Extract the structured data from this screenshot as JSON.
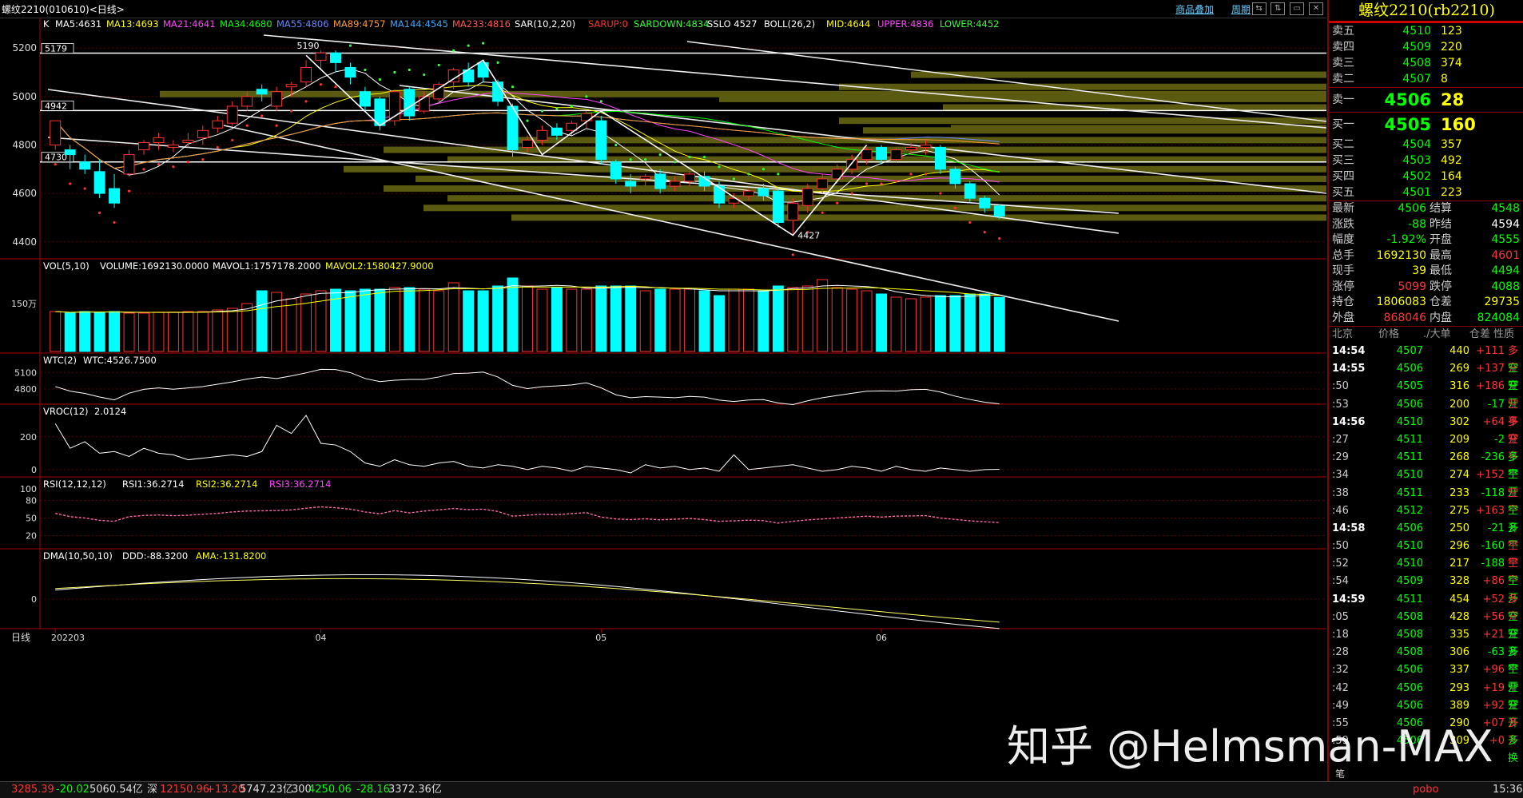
{
  "window": {
    "title": "螺纹2210(010610)<日线>",
    "links": [
      "商品叠加",
      "周期"
    ],
    "buttons": [
      "⇆",
      "⇅",
      "▭",
      "✕"
    ]
  },
  "panes": {
    "main": {
      "legend": [
        {
          "t": "K",
          "color": "#ffffff"
        },
        {
          "t": "MA5:4631",
          "color": "#ffffff"
        },
        {
          "t": "MA13:4693",
          "color": "#ffff00"
        },
        {
          "t": "MA21:4641",
          "color": "#ff44ff"
        },
        {
          "t": "MA34:4680",
          "color": "#00ff00"
        },
        {
          "t": "MA55:4806",
          "color": "#6688ff"
        },
        {
          "t": "MA89:4757",
          "color": "#ff9933"
        },
        {
          "t": "MA144:4545",
          "color": "#33aaff"
        },
        {
          "t": "MA233:4816",
          "color": "#ff5555"
        },
        {
          "t": "SAR(10,2,20)",
          "color": "#ffffff"
        },
        {
          "t": "SARUP:0",
          "color": "#ff3333"
        },
        {
          "t": "SARDOWN:4834",
          "color": "#33ff33"
        },
        {
          "t": "SSLO 4527",
          "color": "#ffffff"
        },
        {
          "t": "BOLL(26,2)",
          "color": "#ffffff"
        },
        {
          "t": "MID:4644",
          "color": "#ffff00"
        },
        {
          "t": "UPPER:4836",
          "color": "#ff44ff"
        },
        {
          "t": "LOWER:4452",
          "color": "#33ff33"
        }
      ],
      "yaxis": [
        "5200",
        "5000",
        "4800",
        "4600",
        "4400"
      ],
      "levels": [
        "5179",
        "4942",
        "4730"
      ],
      "annotations": [
        "5190",
        "4427"
      ]
    },
    "vol": {
      "legend": [
        {
          "t": "VOL(5,10)",
          "color": "#ffffff"
        },
        {
          "t": "VOLUME:1692130.0000",
          "color": "#ffffff"
        },
        {
          "t": "MAVOL1:1757178.2000",
          "color": "#ffffff"
        },
        {
          "t": "MAVOL2:1580427.9000",
          "color": "#ffff00"
        }
      ],
      "yaxis": [
        "150万"
      ]
    },
    "wtc": {
      "legend": [
        {
          "t": "WTC(2)",
          "color": "#ffffff"
        },
        {
          "t": "WTC:4526.7500",
          "color": "#ffffff"
        }
      ],
      "yaxis": [
        "5100",
        "4800"
      ]
    },
    "vroc": {
      "legend": [
        {
          "t": "VROC(12)",
          "color": "#ffffff"
        },
        {
          "t": "2.0124",
          "color": "#ffffff"
        }
      ],
      "yaxis": [
        "200",
        "0"
      ]
    },
    "rsi": {
      "legend": [
        {
          "t": "RSI(12,12,12)",
          "color": "#ffffff"
        },
        {
          "t": "RSI1:36.2714",
          "color": "#ffffff"
        },
        {
          "t": "RSI2:36.2714",
          "color": "#ffff00"
        },
        {
          "t": "RSI3:36.2714",
          "color": "#ff44ff"
        }
      ],
      "yaxis": [
        "100",
        "80",
        "50",
        "20"
      ]
    },
    "dma": {
      "legend": [
        {
          "t": "DMA(10,50,10)",
          "color": "#ffffff"
        },
        {
          "t": "DDD:-88.3200",
          "color": "#ffffff"
        },
        {
          "t": "AMA:-131.8200",
          "color": "#ffff00"
        }
      ],
      "yaxis": [
        "0"
      ]
    }
  },
  "xaxis": {
    "corner": "日线",
    "labels": [
      "202203",
      "04",
      "05",
      "06"
    ]
  },
  "chart_data": {
    "type": "candlestick",
    "title": "螺纹2210(010610)<日线>",
    "ylim": [
      4330,
      5260
    ],
    "x": [
      "202203",
      "04",
      "05",
      "06"
    ],
    "candles": [
      [
        4800,
        4900,
        4780,
        4890
      ],
      [
        4780,
        4760,
        4700,
        4800
      ],
      [
        4730,
        4700,
        4680,
        4760
      ],
      [
        4690,
        4600,
        4580,
        4740
      ],
      [
        4620,
        4560,
        4540,
        4680
      ],
      [
        4680,
        4760,
        4670,
        4780
      ],
      [
        4780,
        4810,
        4760,
        4820
      ],
      [
        4810,
        4830,
        4780,
        4850
      ],
      [
        4790,
        4800,
        4770,
        4820
      ],
      [
        4810,
        4820,
        4790,
        4850
      ],
      [
        4830,
        4860,
        4800,
        4880
      ],
      [
        4870,
        4900,
        4850,
        4920
      ],
      [
        4890,
        4960,
        4880,
        4980
      ],
      [
        4960,
        5000,
        4940,
        5020
      ],
      [
        5030,
        5010,
        4980,
        5050
      ],
      [
        4960,
        5020,
        4940,
        5040
      ],
      [
        5040,
        5050,
        5000,
        5060
      ],
      [
        5060,
        5120,
        5040,
        5150
      ],
      [
        5150,
        5180,
        5110,
        5190
      ],
      [
        5180,
        5140,
        5100,
        5190
      ],
      [
        5120,
        5080,
        5050,
        5140
      ],
      [
        5020,
        4960,
        4940,
        5040
      ],
      [
        4990,
        4880,
        4860,
        5000
      ],
      [
        4900,
        5020,
        4880,
        5030
      ],
      [
        5030,
        4920,
        4900,
        5040
      ],
      [
        4940,
        5000,
        4930,
        5020
      ],
      [
        4990,
        5050,
        4970,
        5060
      ],
      [
        5060,
        5110,
        5030,
        5120
      ],
      [
        5110,
        5060,
        5040,
        5140
      ],
      [
        5140,
        5080,
        5060,
        5150
      ],
      [
        5060,
        4980,
        4960,
        5070
      ],
      [
        4960,
        4780,
        4750,
        4970
      ],
      [
        4790,
        4820,
        4770,
        4840
      ],
      [
        4820,
        4860,
        4800,
        4880
      ],
      [
        4870,
        4840,
        4820,
        4890
      ],
      [
        4860,
        4890,
        4840,
        4900
      ],
      [
        4900,
        4930,
        4870,
        4940
      ],
      [
        4900,
        4740,
        4720,
        4920
      ],
      [
        4730,
        4660,
        4640,
        4740
      ],
      [
        4650,
        4630,
        4600,
        4680
      ],
      [
        4660,
        4670,
        4630,
        4680
      ],
      [
        4680,
        4620,
        4600,
        4700
      ],
      [
        4630,
        4650,
        4610,
        4670
      ],
      [
        4650,
        4680,
        4630,
        4690
      ],
      [
        4670,
        4630,
        4610,
        4690
      ],
      [
        4630,
        4560,
        4540,
        4650
      ],
      [
        4560,
        4580,
        4540,
        4600
      ],
      [
        4590,
        4610,
        4570,
        4620
      ],
      [
        4620,
        4590,
        4570,
        4640
      ],
      [
        4610,
        4480,
        4460,
        4620
      ],
      [
        4490,
        4560,
        4427,
        4580
      ],
      [
        4550,
        4620,
        4520,
        4640
      ],
      [
        4620,
        4660,
        4600,
        4680
      ],
      [
        4660,
        4700,
        4640,
        4720
      ],
      [
        4700,
        4740,
        4680,
        4760
      ],
      [
        4740,
        4780,
        4720,
        4790
      ],
      [
        4790,
        4740,
        4720,
        4800
      ],
      [
        4740,
        4780,
        4730,
        4790
      ],
      [
        4780,
        4790,
        4760,
        4810
      ],
      [
        4790,
        4800,
        4760,
        4820
      ],
      [
        4790,
        4700,
        4680,
        4800
      ],
      [
        4700,
        4640,
        4620,
        4710
      ],
      [
        4640,
        4580,
        4560,
        4650
      ],
      [
        4580,
        4540,
        4520,
        4590
      ],
      [
        4548,
        4506,
        4494,
        4555
      ]
    ],
    "volume": [
      1250000,
      1200000,
      1250000,
      1230000,
      1250000,
      1200000,
      1200000,
      1230000,
      1230000,
      1250000,
      1250000,
      1300000,
      1350000,
      1500000,
      1900000,
      1850000,
      1650000,
      1800000,
      1900000,
      1950000,
      1900000,
      1950000,
      1950000,
      2000000,
      2000000,
      1950000,
      1900000,
      2150000,
      1900000,
      1900000,
      2050000,
      2300000,
      2050000,
      1950000,
      2000000,
      1950000,
      1950000,
      2050000,
      2050000,
      2050000,
      1900000,
      1950000,
      1950000,
      1950000,
      1900000,
      1750000,
      1950000,
      1950000,
      1900000,
      2050000,
      2000000,
      2050000,
      2250000,
      2000000,
      1950000,
      1900000,
      1800000,
      1700000,
      1650000,
      1700000,
      1750000,
      1750000,
      1800000,
      1800000,
      1692130
    ]
  },
  "quote": {
    "name": "螺纹2210(rb2210)",
    "asks": [
      [
        "卖五",
        "4510",
        "123"
      ],
      [
        "卖四",
        "4509",
        "220"
      ],
      [
        "卖三",
        "4508",
        "374"
      ],
      [
        "卖二",
        "4507",
        "8"
      ]
    ],
    "ask1": [
      "卖一",
      "4506",
      "28"
    ],
    "bid1": [
      "买一",
      "4505",
      "160"
    ],
    "bids": [
      [
        "买二",
        "4504",
        "357"
      ],
      [
        "买三",
        "4503",
        "492"
      ],
      [
        "买四",
        "4502",
        "164"
      ],
      [
        "买五",
        "4501",
        "223"
      ]
    ],
    "stats": [
      {
        "l1": "最新",
        "v1": "4506",
        "c1": "#0f0",
        "l2": "结算",
        "v2": "4548",
        "c2": "#0f0"
      },
      {
        "l1": "涨跌",
        "v1": "-88",
        "c1": "#0f0",
        "l2": "昨结",
        "v2": "4594",
        "c2": "#fff"
      },
      {
        "l1": "幅度",
        "v1": "-1.92%",
        "c1": "#0f0",
        "l2": "开盘",
        "v2": "4555",
        "c2": "#0f0"
      },
      {
        "l1": "总手",
        "v1": "1692130",
        "c1": "#ff0",
        "l2": "最高",
        "v2": "4601",
        "c2": "#f33"
      },
      {
        "l1": "现手",
        "v1": "39",
        "c1": "#ff0",
        "l2": "最低",
        "v2": "4494",
        "c2": "#0f0"
      },
      {
        "l1": "涨停",
        "v1": "5099",
        "c1": "#f33",
        "l2": "跌停",
        "v2": "4088",
        "c2": "#0f0"
      },
      {
        "l1": "持仓",
        "v1": "1806083",
        "c1": "#ff0",
        "l2": "仓差",
        "v2": "29735",
        "c2": "#ff0"
      },
      {
        "l1": "外盘",
        "v1": "868046",
        "c1": "#f33",
        "l2": "内盘",
        "v2": "824084",
        "c2": "#0f0"
      }
    ],
    "tick_header": [
      "北京",
      "价格",
      "./大单",
      "仓差",
      "性质"
    ],
    "ticks": [
      [
        "14:54",
        "4507",
        "440",
        "+111",
        "多开",
        true
      ],
      [
        "14:55",
        "4506",
        "269",
        "+137",
        "空开",
        true
      ],
      [
        ":50",
        "4505",
        "316",
        "+186",
        "空开",
        false
      ],
      [
        ":53",
        "4506",
        "200",
        "-17",
        "空平",
        false
      ],
      [
        "14:56",
        "4510",
        "302",
        "+64",
        "多开",
        true
      ],
      [
        ":27",
        "4511",
        "209",
        "-2",
        "空平",
        false
      ],
      [
        ":29",
        "4511",
        "268",
        "-236",
        "多平",
        false
      ],
      [
        ":34",
        "4510",
        "274",
        "+152",
        "空开",
        false
      ],
      [
        ":38",
        "4511",
        "233",
        "-118",
        "空平",
        false
      ],
      [
        ":46",
        "4512",
        "275",
        "+163",
        "空开",
        false
      ],
      [
        "14:58",
        "4506",
        "250",
        "-21",
        "多平",
        true
      ],
      [
        ":50",
        "4510",
        "296",
        "-160",
        "空平",
        false
      ],
      [
        ":52",
        "4510",
        "217",
        "-188",
        "空平",
        false
      ],
      [
        ":54",
        "4509",
        "328",
        "+86",
        "空开",
        false
      ],
      [
        "14:59",
        "4511",
        "454",
        "+52",
        "多开",
        true
      ],
      [
        ":05",
        "4508",
        "428",
        "+56",
        "空开",
        false
      ],
      [
        ":18",
        "4508",
        "335",
        "+21",
        "空开",
        false
      ],
      [
        ":28",
        "4508",
        "306",
        "-63",
        "多平",
        false
      ],
      [
        ":32",
        "4506",
        "337",
        "+96",
        "空开",
        false
      ],
      [
        ":42",
        "4506",
        "293",
        "+19",
        "空开",
        false
      ],
      [
        ":49",
        "4506",
        "389",
        "+92",
        "空开",
        false
      ],
      [
        ":55",
        "4506",
        "290",
        "+07",
        "多开",
        false
      ],
      [
        ":59",
        "4506",
        "309",
        "+0",
        "多换",
        false
      ]
    ],
    "tab": "笔"
  },
  "bottom": [
    {
      "t": "3285.39",
      "c": "#f33"
    },
    {
      "t": "-20.02",
      "c": "#0f0"
    },
    {
      "t": "5060.54亿",
      "c": "#ddd"
    },
    {
      "t": "深",
      "c": "#ddd"
    },
    {
      "t": "12150.96",
      "c": "#f33"
    },
    {
      "t": "+13.20",
      "c": "#f33"
    },
    {
      "t": "5747.23亿",
      "c": "#ddd"
    },
    {
      "t": "300",
      "c": "#ddd"
    },
    {
      "t": "4250.06",
      "c": "#0f0"
    },
    {
      "t": "-28.16",
      "c": "#0f0"
    },
    {
      "t": "3372.36亿",
      "c": "#ddd"
    },
    {
      "t": "pobo",
      "c": "#f33"
    },
    {
      "t": "15:36",
      "c": "#ddd"
    }
  ],
  "watermark": "知乎 @Helmsman-MAX"
}
